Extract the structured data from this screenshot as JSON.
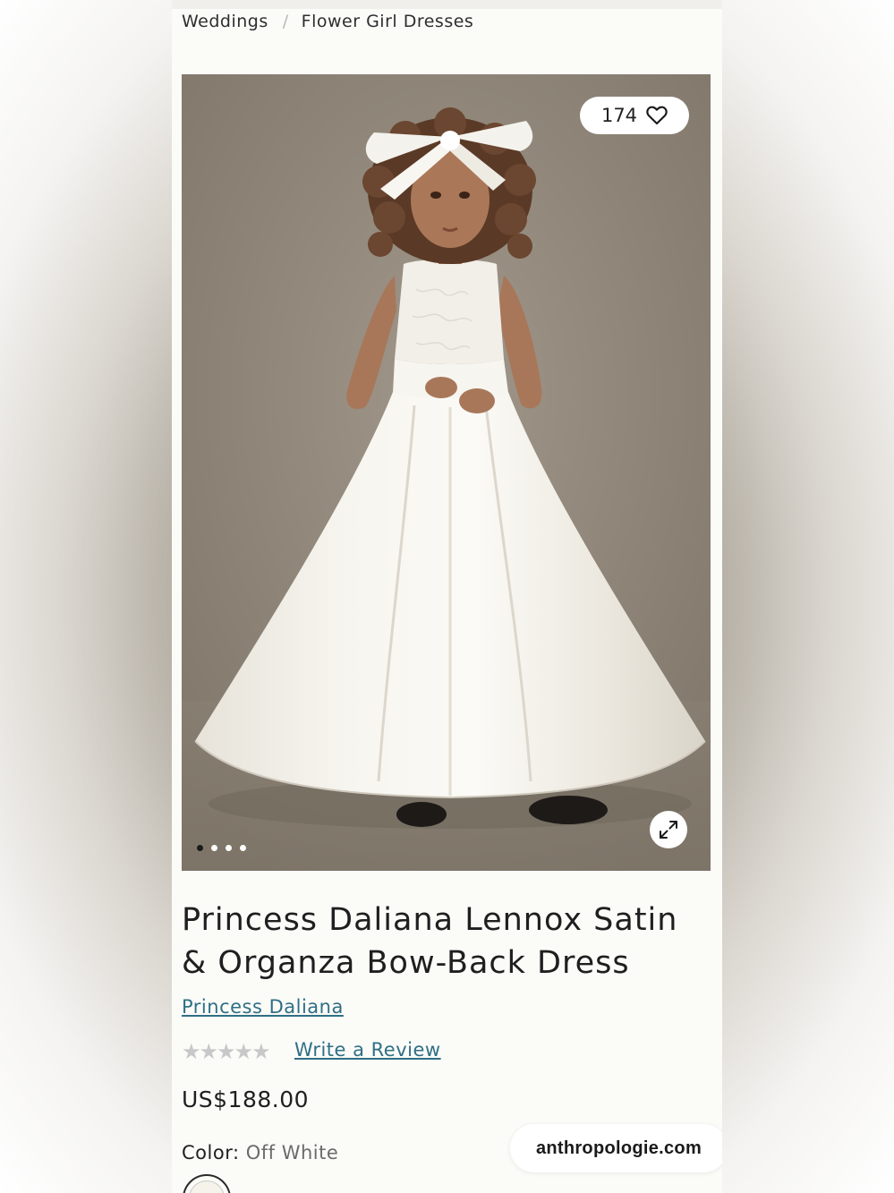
{
  "breadcrumb": {
    "items": [
      "Weddings",
      "Flower Girl Dresses"
    ],
    "separator": "/"
  },
  "gallery": {
    "likes_count": "174",
    "image_count": 4,
    "active_index": 0,
    "image_alt": "Child model wearing white satin ball gown with bow headband"
  },
  "product": {
    "title": "Princess Daliana Lennox Satin & Organza Bow-Back Dress",
    "brand": "Princess Daliana",
    "rating": 0,
    "rating_max": 5,
    "review_link": "Write a Review",
    "price": "US$188.00",
    "color_label": "Color:",
    "color_value": "Off White"
  },
  "browser": {
    "url": "anthropologie.com"
  },
  "colors": {
    "link": "#2f6f86",
    "text": "#1f1f1f",
    "page_bg": "#fbfbf8"
  }
}
